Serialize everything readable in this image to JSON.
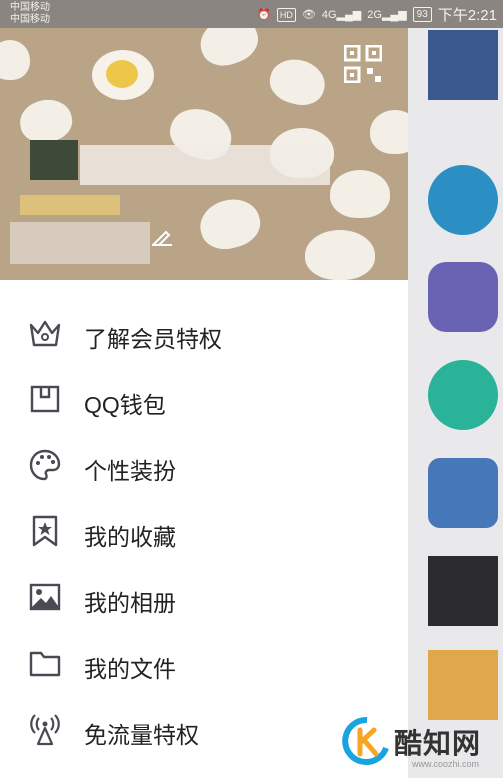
{
  "status_bar": {
    "carrier_1": "中国移动",
    "carrier_2": "中国移动",
    "hd": "HD",
    "net_1": "4G",
    "net_2": "2G",
    "battery": "93",
    "time": "下午2:21"
  },
  "header": {
    "qr_icon": "qr-code-icon",
    "edit_icon": "edit-pencil-icon"
  },
  "menu": {
    "items": [
      {
        "label": "了解会员特权",
        "icon": "crown-icon"
      },
      {
        "label": "QQ钱包",
        "icon": "wallet-icon"
      },
      {
        "label": "个性装扮",
        "icon": "palette-icon"
      },
      {
        "label": "我的收藏",
        "icon": "bookmark-star-icon"
      },
      {
        "label": "我的相册",
        "icon": "photo-icon"
      },
      {
        "label": "我的文件",
        "icon": "folder-icon"
      },
      {
        "label": "免流量特权",
        "icon": "signal-tower-icon"
      }
    ]
  },
  "watermark": {
    "brand": "酷知网",
    "url": "www.coozhi.com"
  },
  "colors": {
    "header_bg": "#b9a488",
    "icon_stroke": "#4a4a55",
    "text": "#222222"
  }
}
